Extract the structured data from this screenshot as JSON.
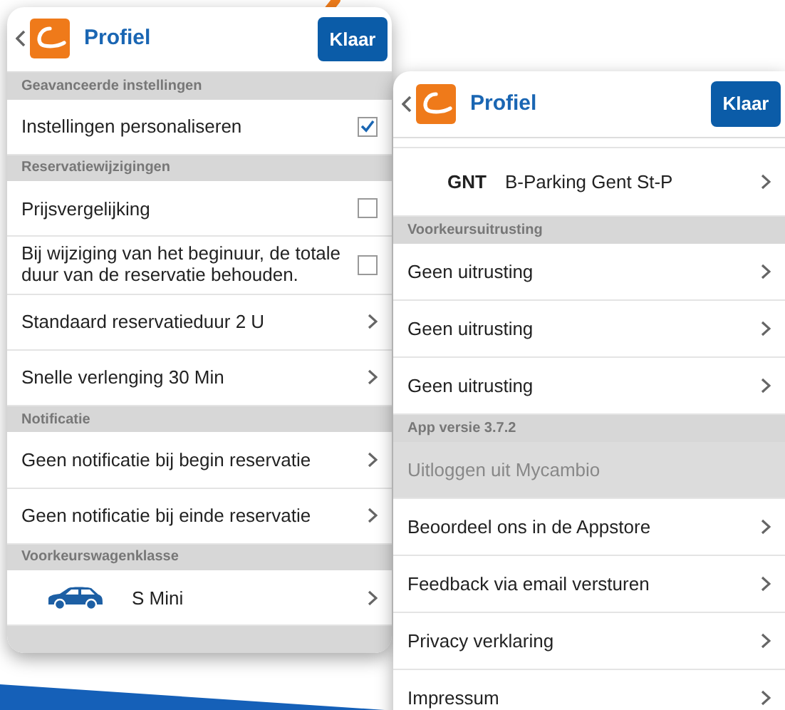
{
  "panels": [
    {
      "title": "Profiel",
      "done_button": "Klaar",
      "items": [
        {
          "kind": "section",
          "label": "Geavanceerde instellingen"
        },
        {
          "kind": "check",
          "label": "Instellingen personaliseren",
          "checked": true
        },
        {
          "kind": "section",
          "label": "Reservatiewijzigingen"
        },
        {
          "kind": "check",
          "label": "Prijsvergelijking",
          "checked": false
        },
        {
          "kind": "check",
          "label": "Bij wijziging van het beginuur, de totale duur van de reservatie behouden.",
          "checked": false
        },
        {
          "kind": "link",
          "label": "Standaard reservatieduur 2 U",
          "disabled": false
        },
        {
          "kind": "link",
          "label": "Snelle verlenging 30 Min",
          "disabled": false
        },
        {
          "kind": "section",
          "label": "Notificatie"
        },
        {
          "kind": "link",
          "label": "Geen notificatie bij begin reservatie",
          "disabled": false
        },
        {
          "kind": "link",
          "label": "Geen notificatie bij einde reservatie",
          "disabled": false
        },
        {
          "kind": "section",
          "label": "Voorkeurswagenklasse"
        },
        {
          "kind": "car",
          "label": "S Mini"
        }
      ]
    },
    {
      "title": "Profiel",
      "done_button": "Klaar",
      "items": [
        {
          "kind": "station",
          "code": "GNT",
          "label": "B-Parking Gent St-P"
        },
        {
          "kind": "section",
          "label": "Voorkeursuitrusting"
        },
        {
          "kind": "link",
          "label": "Geen uitrusting",
          "disabled": false
        },
        {
          "kind": "link",
          "label": "Geen uitrusting",
          "disabled": false
        },
        {
          "kind": "link",
          "label": "Geen uitrusting",
          "disabled": false
        },
        {
          "kind": "section",
          "label": "App versie 3.7.2"
        },
        {
          "kind": "link",
          "label": "Uitloggen uit Mycambio",
          "disabled": true
        },
        {
          "kind": "link",
          "label": "Beoordeel ons in de Appstore",
          "disabled": false
        },
        {
          "kind": "link",
          "label": "Feedback via email versturen",
          "disabled": false
        },
        {
          "kind": "link",
          "label": "Privacy verklaring",
          "disabled": false
        },
        {
          "kind": "link",
          "label": "Impressum",
          "disabled": false
        }
      ]
    }
  ]
}
